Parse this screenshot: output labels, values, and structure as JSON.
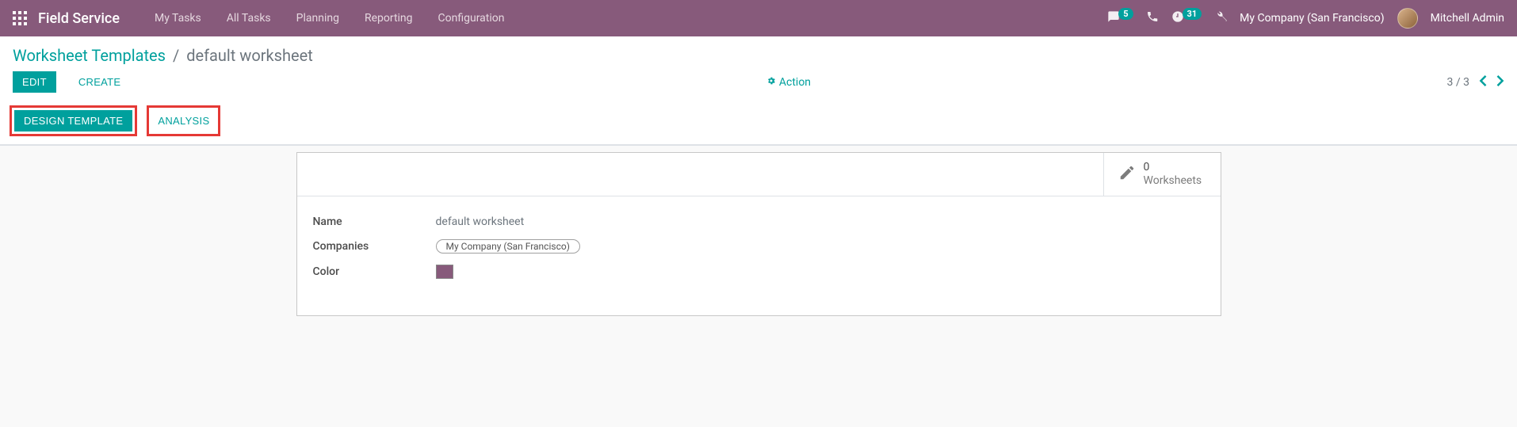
{
  "app_title": "Field Service",
  "nav": {
    "items": [
      "My Tasks",
      "All Tasks",
      "Planning",
      "Reporting",
      "Configuration"
    ]
  },
  "systray": {
    "messages_badge": "5",
    "activities_badge": "31",
    "company": "My Company (San Francisco)",
    "user": "Mitchell Admin"
  },
  "breadcrumbs": {
    "root": "Worksheet Templates",
    "current": "default worksheet"
  },
  "buttons": {
    "edit": "Edit",
    "create": "Create",
    "action": "Action",
    "design_template": "Design Template",
    "analysis": "Analysis"
  },
  "pager": {
    "text": "3 / 3"
  },
  "stat": {
    "count": "0",
    "label": "Worksheets"
  },
  "form": {
    "name_label": "Name",
    "name_value": "default worksheet",
    "companies_label": "Companies",
    "companies_value": "My Company (San Francisco)",
    "color_label": "Color",
    "color_hex": "#875a7b"
  }
}
